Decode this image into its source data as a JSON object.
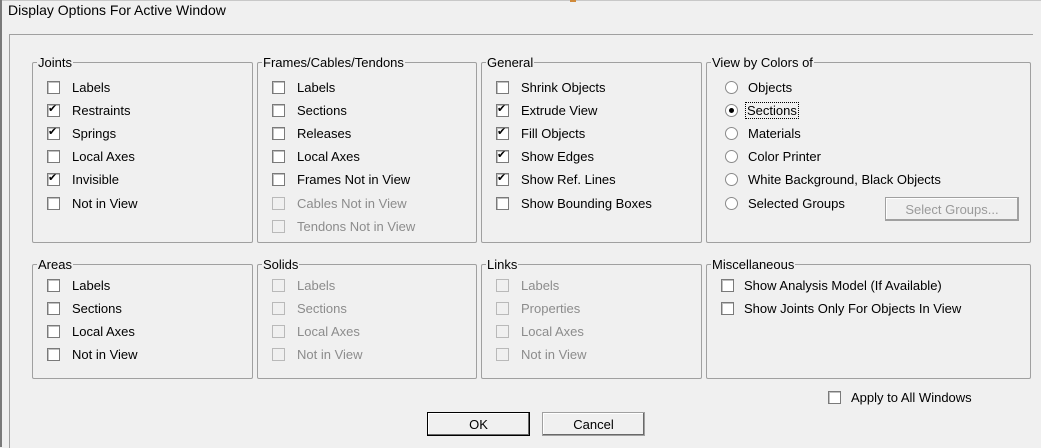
{
  "window": {
    "title": "Display Options For Active Window"
  },
  "joints": {
    "legend": "Joints",
    "items": [
      {
        "label": "Labels",
        "checked": false,
        "enabled": true
      },
      {
        "label": "Restraints",
        "checked": true,
        "enabled": true
      },
      {
        "label": "Springs",
        "checked": true,
        "enabled": true
      },
      {
        "label": "Local Axes",
        "checked": false,
        "enabled": true
      },
      {
        "label": "Invisible",
        "checked": true,
        "enabled": true
      },
      {
        "label": "Not in View",
        "checked": false,
        "enabled": true
      }
    ]
  },
  "frames": {
    "legend": "Frames/Cables/Tendons",
    "items": [
      {
        "label": "Labels",
        "checked": false,
        "enabled": true
      },
      {
        "label": "Sections",
        "checked": false,
        "enabled": true
      },
      {
        "label": "Releases",
        "checked": false,
        "enabled": true
      },
      {
        "label": "Local Axes",
        "checked": false,
        "enabled": true
      },
      {
        "label": "Frames Not in View",
        "checked": false,
        "enabled": true
      },
      {
        "label": "Cables Not in View",
        "checked": false,
        "enabled": false
      },
      {
        "label": "Tendons Not in View",
        "checked": false,
        "enabled": false
      }
    ]
  },
  "general": {
    "legend": "General",
    "items": [
      {
        "label": "Shrink Objects",
        "checked": false,
        "enabled": true
      },
      {
        "label": "Extrude View",
        "checked": true,
        "enabled": true
      },
      {
        "label": "Fill Objects",
        "checked": true,
        "enabled": true
      },
      {
        "label": "Show Edges",
        "checked": true,
        "enabled": true
      },
      {
        "label": "Show Ref. Lines",
        "checked": true,
        "enabled": true
      },
      {
        "label": "Show Bounding Boxes",
        "checked": false,
        "enabled": true
      }
    ]
  },
  "view_colors": {
    "legend": "View by Colors of",
    "options": [
      {
        "label": "Objects",
        "selected": false
      },
      {
        "label": "Sections",
        "selected": true
      },
      {
        "label": "Materials",
        "selected": false
      },
      {
        "label": "Color Printer",
        "selected": false
      },
      {
        "label": "White Background, Black Objects",
        "selected": false
      },
      {
        "label": "Selected Groups",
        "selected": false
      }
    ],
    "select_groups_button": "Select Groups..."
  },
  "areas": {
    "legend": "Areas",
    "items": [
      {
        "label": "Labels",
        "checked": false,
        "enabled": true
      },
      {
        "label": "Sections",
        "checked": false,
        "enabled": true
      },
      {
        "label": "Local Axes",
        "checked": false,
        "enabled": true
      },
      {
        "label": "Not in View",
        "checked": false,
        "enabled": true
      }
    ]
  },
  "solids": {
    "legend": "Solids",
    "items": [
      {
        "label": "Labels",
        "checked": false,
        "enabled": false
      },
      {
        "label": "Sections",
        "checked": false,
        "enabled": false
      },
      {
        "label": "Local Axes",
        "checked": false,
        "enabled": false
      },
      {
        "label": "Not in View",
        "checked": false,
        "enabled": false
      }
    ]
  },
  "links": {
    "legend": "Links",
    "items": [
      {
        "label": "Labels",
        "checked": false,
        "enabled": false
      },
      {
        "label": "Properties",
        "checked": false,
        "enabled": false
      },
      {
        "label": "Local Axes",
        "checked": false,
        "enabled": false
      },
      {
        "label": "Not in View",
        "checked": false,
        "enabled": false
      }
    ]
  },
  "misc": {
    "legend": "Miscellaneous",
    "items": [
      {
        "label": "Show Analysis Model  (If Available)",
        "checked": false,
        "enabled": true
      },
      {
        "label": "Show Joints Only For Objects In View",
        "checked": false,
        "enabled": true
      }
    ]
  },
  "apply_all": {
    "label": "Apply to All Windows",
    "checked": false
  },
  "buttons": {
    "ok": "OK",
    "cancel": "Cancel"
  }
}
